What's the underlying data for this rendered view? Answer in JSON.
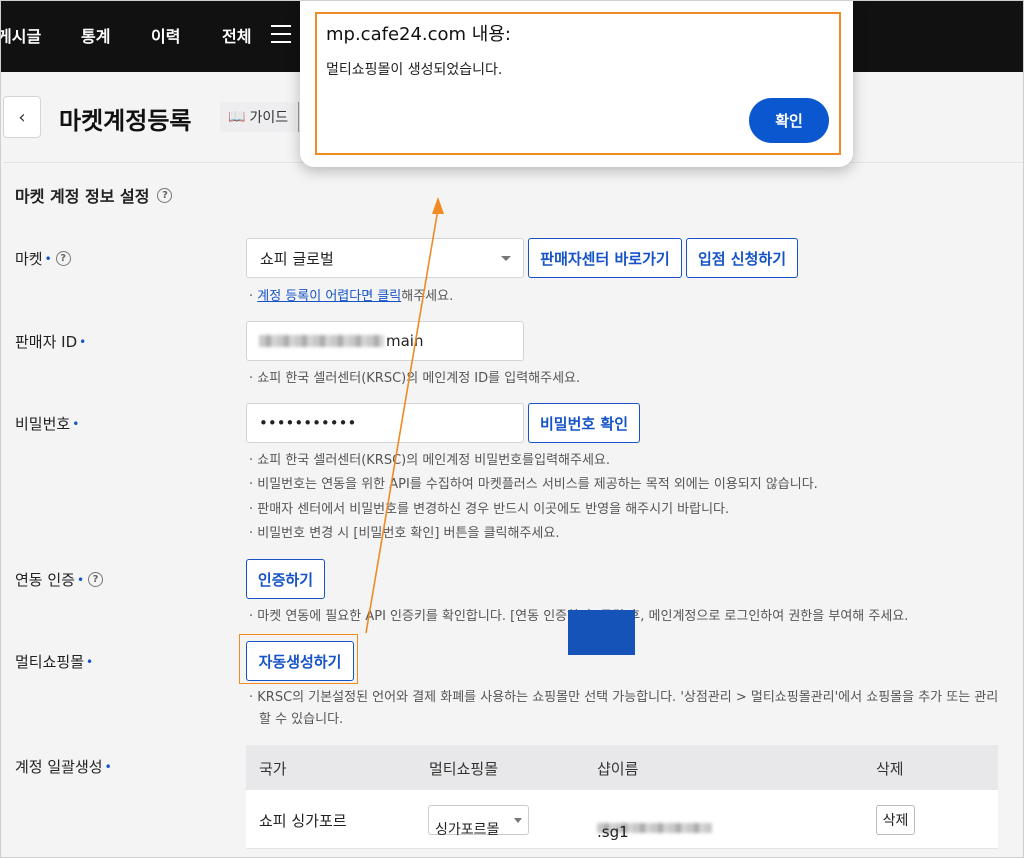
{
  "nav": {
    "items": [
      "게시글",
      "통계",
      "이력",
      "전체"
    ]
  },
  "header": {
    "back_icon": "chevron-left-icon",
    "title": "마켓계정등록",
    "guide_label": "가이드"
  },
  "section": {
    "title": "마켓 계정 정보 설정"
  },
  "market": {
    "label": "마켓",
    "select_value": "쇼피 글로벌",
    "seller_center_btn": "판매자센터 바로가기",
    "apply_btn": "입점 신청하기",
    "help_link": "계정 등록이 어렵다면 클릭",
    "help_rest": "해주세요."
  },
  "seller_id": {
    "label": "판매자 ID",
    "value_suffix": "main",
    "help": "쇼피 한국 셀러센터(KRSC)의 메인계정 ID를 입력해주세요."
  },
  "password": {
    "label": "비밀번호",
    "value": "•••••••••••",
    "confirm_btn": "비밀번호 확인",
    "help": [
      "쇼피 한국 셀러센터(KRSC)의 메인계정 비밀번호를입력해주세요.",
      "비밀번호는 연동을 위한 API를 수집하여 마켓플러스 서비스를 제공하는 목적 외에는 이용되지 않습니다.",
      "판매자 센터에서 비밀번호를 변경하신 경우 반드시 이곳에도 반영을 해주시기 바랍니다.",
      "비밀번호 변경 시 [비밀번호 확인] 버튼을 클릭해주세요."
    ]
  },
  "auth": {
    "label": "연동 인증",
    "btn": "인증하기",
    "help": "마켓 연동에 필요한 API 인증키를 확인합니다. [연동 인증하기] 클릭 후, 메인계정으로 로그인하여 권한을 부여해 주세요."
  },
  "multi": {
    "label": "멀티쇼핑몰",
    "btn": "자동생성하기",
    "help": "KRSC의 기본설정된 언어와 결제 화폐를 사용하는 쇼핑몰만 선택 가능합니다. '상점관리 > 멀티쇼핑몰관리'에서 쇼핑몰을 추가 또는 관리",
    "help2": "할 수 있습니다."
  },
  "bulk": {
    "label": "계정 일괄생성",
    "columns": [
      "국가",
      "멀티쇼핑몰",
      "샵이름",
      "삭제"
    ],
    "rows": [
      {
        "country": "쇼피 싱가포르",
        "mall": "싱가포르몰",
        "shop_suffix": ".sg1",
        "delete": "삭제"
      }
    ]
  },
  "dialog": {
    "title": "mp.cafe24.com 내용:",
    "message": "멀티쇼핑몰이 생성되었습니다.",
    "ok": "확인"
  },
  "colors": {
    "accent": "#1553c6",
    "highlight": "#f08a24",
    "dialog_button": "#0b57d0"
  }
}
